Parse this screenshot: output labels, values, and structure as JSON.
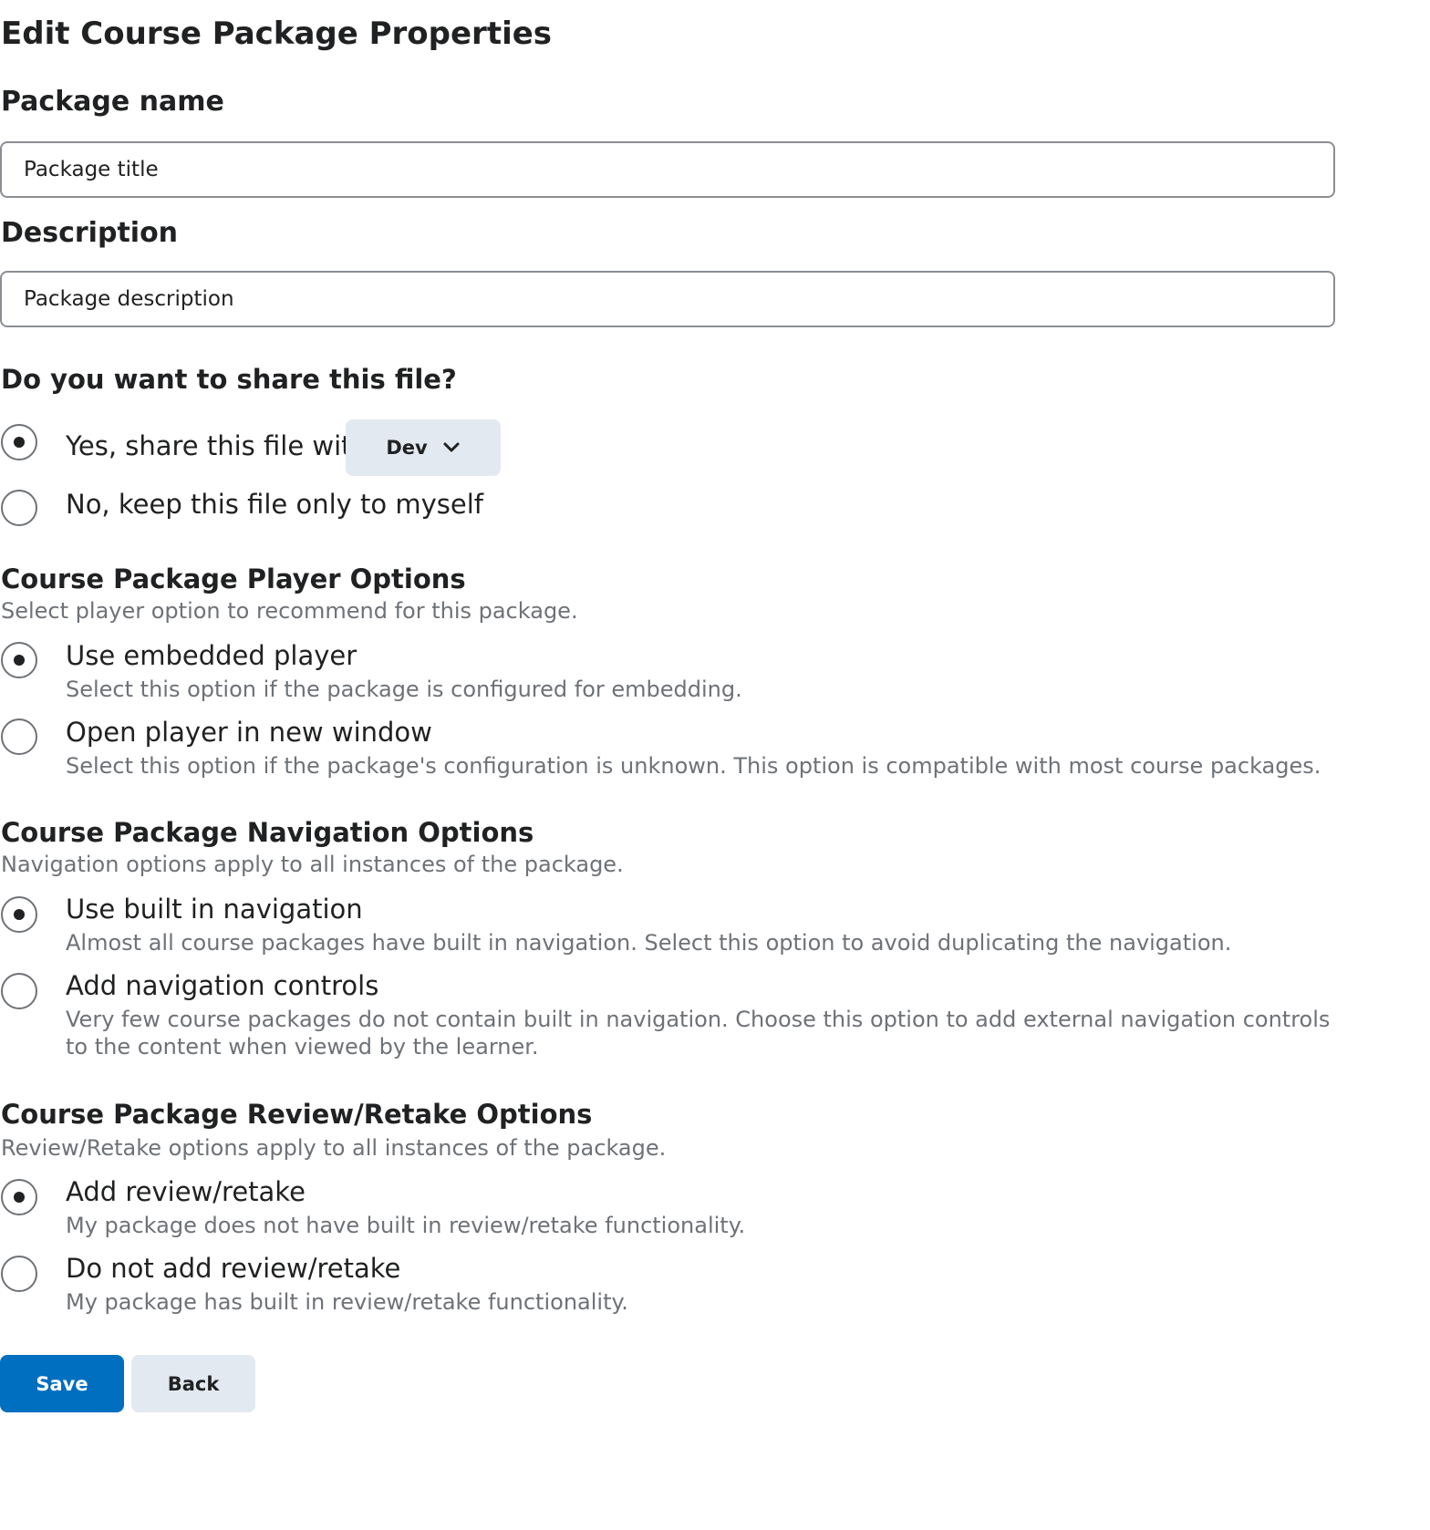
{
  "page": {
    "title": "Edit Course Package Properties"
  },
  "package_name": {
    "label": "Package name",
    "value": "Package title",
    "placeholder": "Package title"
  },
  "description": {
    "label": "Description",
    "value": "Package description",
    "placeholder": "Package description"
  },
  "sharing": {
    "question": "Do you want to share this file?",
    "options": [
      {
        "label": "Yes, share this file with",
        "selected": true
      },
      {
        "label": "No, keep this file only to myself",
        "selected": false
      }
    ],
    "share_target": {
      "selected": "Dev",
      "icon": "chevron-down-icon"
    }
  },
  "player_options": {
    "heading": "Course Package Player Options",
    "description": "Select player option to recommend for this package.",
    "options": [
      {
        "label": "Use embedded player",
        "description": "Select this option if the package is configured for embedding.",
        "selected": true
      },
      {
        "label": "Open player in new window",
        "description": "Select this option if the package's configuration is unknown. This option is compatible with most course packages.",
        "selected": false
      }
    ]
  },
  "navigation_options": {
    "heading": "Course Package Navigation Options",
    "description": "Navigation options apply to all instances of the package.",
    "options": [
      {
        "label": "Use built in navigation",
        "description": "Almost all course packages have built in navigation. Select this option to avoid duplicating the navigation.",
        "selected": true
      },
      {
        "label": "Add navigation controls",
        "description": "Very few course packages do not contain built in navigation. Choose this option to add external navigation controls to the content when viewed by the learner.",
        "selected": false
      }
    ]
  },
  "review_options": {
    "heading": "Course Package Review/Retake Options",
    "description": "Review/Retake options apply to all instances of the package.",
    "options": [
      {
        "label": "Add review/retake",
        "description": "My package does not have built in review/retake functionality.",
        "selected": true
      },
      {
        "label": "Do not add review/retake",
        "description": "My package has built in review/retake functionality.",
        "selected": false
      }
    ]
  },
  "actions": {
    "save_label": "Save",
    "back_label": "Back"
  },
  "colors": {
    "primary": "#006fbf",
    "secondary_button": "#e3e9f1",
    "text": "#202122",
    "muted_text": "#6e7277",
    "border": "#8b8e93"
  }
}
